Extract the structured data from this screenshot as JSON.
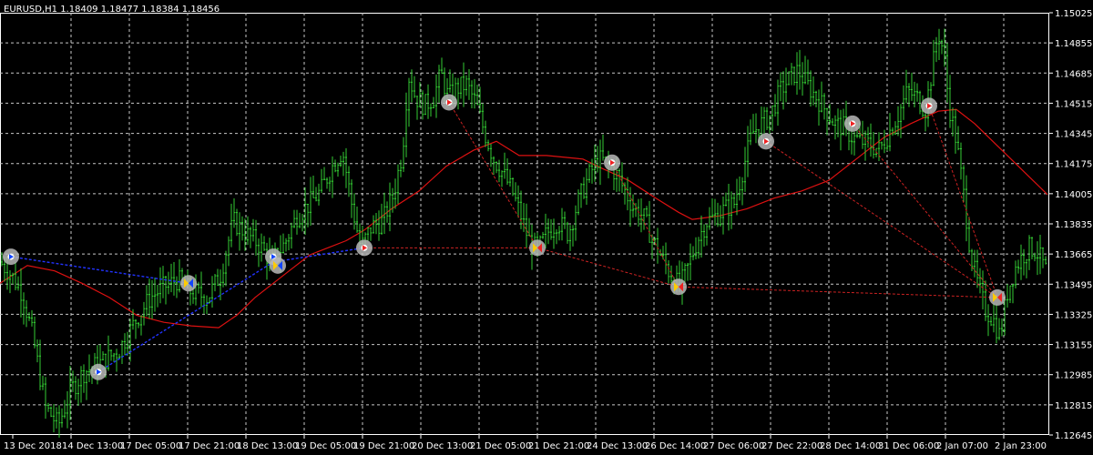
{
  "chart_data": {
    "type": "candlestick",
    "title": "EURUSD,H1  1.18409 1.18477 1.18384 1.18456",
    "ylim": [
      1.12645,
      1.15025
    ],
    "y_ticks": [
      "1.15025",
      "1.14855",
      "1.14685",
      "1.14515",
      "1.14345",
      "1.14175",
      "1.14005",
      "1.13835",
      "1.13665",
      "1.13495",
      "1.13325",
      "1.13155",
      "1.12985",
      "1.12815",
      "1.12645"
    ],
    "x_ticks": [
      "13 Dec 2018",
      "14 Dec 13:00",
      "17 Dec 05:00",
      "17 Dec 21:00",
      "18 Dec 13:00",
      "19 Dec 05:00",
      "19 Dec 21:00",
      "20 Dec 13:00",
      "21 Dec 05:00",
      "21 Dec 21:00",
      "24 Dec 13:00",
      "26 Dec 14:00",
      "27 Dec 06:00",
      "27 Dec 22:00",
      "28 Dec 14:00",
      "31 Dec 06:00",
      "2 Jan 07:00",
      "2 Jan 23:00"
    ],
    "grid": true,
    "colors": {
      "background": "#000000",
      "grid": "#c8c8c8",
      "candle": "#33cc33",
      "moving_average": "#dd1111",
      "buy_trade_line": "#2233ff",
      "sell_trade_line": "#cc2222",
      "marker_ring": "#b8b8b8",
      "buy_marker": "#1144ff",
      "sell_marker": "#ee2222"
    },
    "price_path": [
      [
        0,
        1.1362
      ],
      [
        12,
        1.1355
      ],
      [
        24,
        1.1345
      ],
      [
        36,
        1.132
      ],
      [
        50,
        1.128
      ],
      [
        64,
        1.127
      ],
      [
        78,
        1.129
      ],
      [
        92,
        1.13
      ],
      [
        110,
        1.1305
      ],
      [
        130,
        1.1312
      ],
      [
        150,
        1.133
      ],
      [
        165,
        1.1342
      ],
      [
        180,
        1.1348
      ],
      [
        195,
        1.1352
      ],
      [
        210,
        1.1345
      ],
      [
        228,
        1.1342
      ],
      [
        242,
        1.1355
      ],
      [
        256,
        1.1385
      ],
      [
        270,
        1.1378
      ],
      [
        284,
        1.1372
      ],
      [
        298,
        1.1362
      ],
      [
        312,
        1.1372
      ],
      [
        326,
        1.1388
      ],
      [
        340,
        1.1395
      ],
      [
        352,
        1.1402
      ],
      [
        364,
        1.1415
      ],
      [
        376,
        1.1425
      ],
      [
        386,
        1.1395
      ],
      [
        396,
        1.137
      ],
      [
        408,
        1.1382
      ],
      [
        420,
        1.1385
      ],
      [
        432,
        1.14
      ],
      [
        442,
        1.1425
      ],
      [
        448,
        1.1468
      ],
      [
        456,
        1.1455
      ],
      [
        466,
        1.145
      ],
      [
        476,
        1.1455
      ],
      [
        484,
        1.1468
      ],
      [
        492,
        1.1455
      ],
      [
        502,
        1.146
      ],
      [
        512,
        1.1462
      ],
      [
        522,
        1.1452
      ],
      [
        532,
        1.1435
      ],
      [
        542,
        1.142
      ],
      [
        552,
        1.1412
      ],
      [
        562,
        1.1402
      ],
      [
        572,
        1.1388
      ],
      [
        580,
        1.1375
      ],
      [
        590,
        1.1368
      ],
      [
        600,
        1.1378
      ],
      [
        612,
        1.1385
      ],
      [
        624,
        1.1378
      ],
      [
        634,
        1.1395
      ],
      [
        646,
        1.141
      ],
      [
        656,
        1.142
      ],
      [
        666,
        1.1418
      ],
      [
        676,
        1.1412
      ],
      [
        686,
        1.1402
      ],
      [
        696,
        1.1392
      ],
      [
        706,
        1.1388
      ],
      [
        716,
        1.1375
      ],
      [
        726,
        1.1365
      ],
      [
        736,
        1.1355
      ],
      [
        746,
        1.1348
      ],
      [
        756,
        1.136
      ],
      [
        766,
        1.1375
      ],
      [
        776,
        1.1385
      ],
      [
        786,
        1.1388
      ],
      [
        796,
        1.1392
      ],
      [
        806,
        1.1395
      ],
      [
        816,
        1.1415
      ],
      [
        826,
        1.1435
      ],
      [
        836,
        1.144
      ],
      [
        846,
        1.1445
      ],
      [
        856,
        1.1458
      ],
      [
        866,
        1.1465
      ],
      [
        876,
        1.147
      ],
      [
        886,
        1.1462
      ],
      [
        896,
        1.1455
      ],
      [
        906,
        1.1448
      ],
      [
        916,
        1.144
      ],
      [
        926,
        1.1438
      ],
      [
        936,
        1.1432
      ],
      [
        946,
        1.143
      ],
      [
        956,
        1.1428
      ],
      [
        966,
        1.1425
      ],
      [
        976,
        1.1435
      ],
      [
        986,
        1.1445
      ],
      [
        996,
        1.1458
      ],
      [
        1006,
        1.1455
      ],
      [
        1016,
        1.1448
      ],
      [
        1024,
        1.1472
      ],
      [
        1030,
        1.1492
      ],
      [
        1036,
        1.148
      ],
      [
        1042,
        1.145
      ],
      [
        1050,
        1.143
      ],
      [
        1058,
        1.14
      ],
      [
        1066,
        1.1365
      ],
      [
        1074,
        1.1348
      ],
      [
        1082,
        1.1335
      ],
      [
        1090,
        1.133
      ],
      [
        1098,
        1.132
      ],
      [
        1106,
        1.1345
      ],
      [
        1114,
        1.1358
      ],
      [
        1122,
        1.1365
      ],
      [
        1130,
        1.137
      ],
      [
        1138,
        1.1368
      ],
      [
        1146,
        1.136
      ],
      [
        1150,
        1.1355
      ]
    ],
    "moving_average": [
      [
        0,
        1.135
      ],
      [
        30,
        1.136
      ],
      [
        60,
        1.1357
      ],
      [
        90,
        1.135
      ],
      [
        120,
        1.1342
      ],
      [
        150,
        1.1332
      ],
      [
        180,
        1.1328
      ],
      [
        210,
        1.1326
      ],
      [
        240,
        1.1325
      ],
      [
        260,
        1.1332
      ],
      [
        280,
        1.1342
      ],
      [
        300,
        1.135
      ],
      [
        320,
        1.1358
      ],
      [
        340,
        1.1366
      ],
      [
        360,
        1.137
      ],
      [
        380,
        1.1374
      ],
      [
        400,
        1.138
      ],
      [
        430,
        1.1392
      ],
      [
        460,
        1.1402
      ],
      [
        490,
        1.1416
      ],
      [
        520,
        1.1425
      ],
      [
        545,
        1.143
      ],
      [
        570,
        1.1422
      ],
      [
        600,
        1.1422
      ],
      [
        640,
        1.142
      ],
      [
        660,
        1.1415
      ],
      [
        690,
        1.1408
      ],
      [
        720,
        1.1398
      ],
      [
        745,
        1.139
      ],
      [
        760,
        1.1386
      ],
      [
        790,
        1.1388
      ],
      [
        820,
        1.1392
      ],
      [
        850,
        1.1398
      ],
      [
        880,
        1.1402
      ],
      [
        910,
        1.1408
      ],
      [
        940,
        1.142
      ],
      [
        970,
        1.1432
      ],
      [
        1000,
        1.144
      ],
      [
        1030,
        1.1447
      ],
      [
        1050,
        1.1448
      ],
      [
        1070,
        1.144
      ],
      [
        1090,
        1.143
      ],
      [
        1110,
        1.142
      ],
      [
        1130,
        1.141
      ],
      [
        1150,
        1.14
      ]
    ],
    "trades": [
      {
        "type": "buy",
        "open": [
          12,
          1.1365
        ],
        "close": [
          207,
          1.135
        ]
      },
      {
        "type": "buy",
        "open": [
          108,
          1.13
        ],
        "close": [
          300,
          1.1362
        ]
      },
      {
        "type": "buy",
        "open": [
          300,
          1.1362
        ],
        "close": [
          400,
          1.137
        ]
      },
      {
        "type": "sell",
        "open": [
          493,
          1.1452
        ],
        "close": [
          590,
          1.137
        ]
      },
      {
        "type": "sell",
        "open": [
          400,
          1.137
        ],
        "close": [
          590,
          1.137
        ]
      },
      {
        "type": "sell",
        "open": [
          590,
          1.137
        ],
        "close": [
          745,
          1.1348
        ]
      },
      {
        "type": "sell",
        "open": [
          672,
          1.1418
        ],
        "close": [
          745,
          1.1348
        ]
      },
      {
        "type": "sell",
        "open": [
          745,
          1.1348
        ],
        "close": [
          1095,
          1.1342
        ]
      },
      {
        "type": "sell",
        "open": [
          841,
          1.143
        ],
        "close": [
          1095,
          1.1342
        ]
      },
      {
        "type": "sell",
        "open": [
          936,
          1.144
        ],
        "close": [
          1095,
          1.1342
        ]
      },
      {
        "type": "sell",
        "open": [
          1020,
          1.145
        ],
        "close": [
          1095,
          1.1342
        ]
      }
    ],
    "markers": [
      {
        "x": 12,
        "y": 1.1365,
        "kind": "buy-open"
      },
      {
        "x": 108,
        "y": 1.13,
        "kind": "buy-open"
      },
      {
        "x": 207,
        "y": 1.135,
        "kind": "buy-close"
      },
      {
        "x": 300,
        "y": 1.1365,
        "kind": "buy-open"
      },
      {
        "x": 305,
        "y": 1.136,
        "kind": "buy-close"
      },
      {
        "x": 400,
        "y": 1.137,
        "kind": "sell-open"
      },
      {
        "x": 493,
        "y": 1.1452,
        "kind": "sell-open"
      },
      {
        "x": 590,
        "y": 1.137,
        "kind": "sell-close"
      },
      {
        "x": 672,
        "y": 1.1418,
        "kind": "sell-open"
      },
      {
        "x": 745,
        "y": 1.1348,
        "kind": "sell-close"
      },
      {
        "x": 841,
        "y": 1.143,
        "kind": "sell-open"
      },
      {
        "x": 936,
        "y": 1.144,
        "kind": "sell-open"
      },
      {
        "x": 1020,
        "y": 1.145,
        "kind": "sell-open"
      },
      {
        "x": 1095,
        "y": 1.1342,
        "kind": "sell-close"
      }
    ]
  }
}
